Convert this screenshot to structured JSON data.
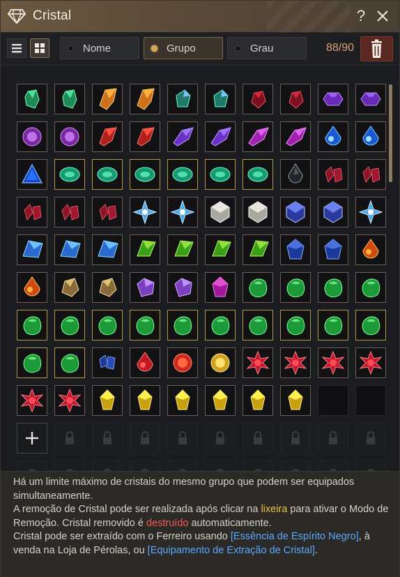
{
  "window": {
    "title": "Cristal"
  },
  "toolbar": {
    "sort_name": "Nome",
    "sort_group": "Grupo",
    "sort_grade": "Grau",
    "active_sort": "Grupo",
    "count": "88/90"
  },
  "colors": {
    "accent": "#d9a54a",
    "count": "#e0a070",
    "trash": "#5a2820",
    "highlight_yellow": "#f0c440",
    "highlight_red": "#f05a5a",
    "highlight_blue": "#5aa8ff"
  },
  "icons": [
    "diamond-logo-icon",
    "help-icon",
    "close-icon",
    "list-view-icon",
    "grid-view-icon",
    "trash-icon",
    "add-icon",
    "lock-icon"
  ],
  "grid": {
    "rows": [
      [
        "emerald-dark",
        "emerald-dark",
        "amber-shard",
        "amber-shard",
        "teal-gem",
        "teal-gem",
        "ruby-dark",
        "ruby-dark",
        "violet-hex",
        "violet-hex"
      ],
      [
        "amethyst-round",
        "amethyst-round",
        "red-shard",
        "red-shard",
        "violet-shard",
        "violet-shard",
        "magenta-shard",
        "magenta-shard",
        "blue-drop",
        "blue-drop"
      ],
      [
        "blue-triangle",
        "green-oval",
        "green-oval",
        "green-oval",
        "green-oval",
        "green-oval",
        "green-oval",
        "black-drop",
        "dark-ruby-cluster",
        "dark-ruby-cluster"
      ],
      [
        "dark-ruby-cluster",
        "dark-ruby-cluster",
        "dark-ruby-cluster",
        "ice-star",
        "ice-star",
        "silver-cube",
        "silver-cube",
        "blue-cube",
        "blue-cube",
        "ice-star"
      ],
      [
        "blue-prism",
        "blue-prism",
        "blue-prism",
        "green-kite",
        "green-kite",
        "green-kite",
        "green-kite",
        "navy-star",
        "navy-star",
        "fire-drop"
      ],
      [
        "fire-drop",
        "gold-chunk",
        "gold-chunk",
        "purple-gem",
        "purple-gem",
        "magenta-gem",
        "green-stone",
        "green-stone",
        "green-stone",
        "green-stone"
      ],
      [
        "green-stone",
        "green-stone",
        "green-stone",
        "green-stone",
        "green-stone",
        "green-stone",
        "green-stone",
        "green-stone",
        "green-stone",
        "green-stone"
      ],
      [
        "green-stone",
        "green-stone",
        "sapphire-cluster",
        "red-drop",
        "red-sun",
        "gold-sun",
        "red-star",
        "red-star",
        "red-star",
        "red-star"
      ],
      [
        "red-star",
        "red-star",
        "yellow-crystal",
        "yellow-crystal",
        "yellow-crystal",
        "yellow-crystal",
        "yellow-crystal",
        "yellow-crystal",
        "empty",
        "empty"
      ],
      [
        "add",
        "locked",
        "locked",
        "locked",
        "locked",
        "locked",
        "locked",
        "locked",
        "locked",
        "locked"
      ],
      [
        "locked",
        "locked",
        "locked",
        "locked",
        "locked",
        "locked",
        "locked",
        "locked",
        "locked",
        "locked"
      ]
    ]
  },
  "info": {
    "line1": "Há um limite máximo de cristais do mesmo grupo que podem ser equipados simultaneamente.",
    "line2_a": "A remoção de Cristal pode ser realizada após clicar na ",
    "line2_hl": "lixeira",
    "line2_b": " para ativar o Modo de Remoção. Cristal removido é ",
    "line2_hl2": "destruído",
    "line2_c": " automaticamente.",
    "line3_a": "Cristal pode ser extraído com o Ferreiro usando ",
    "line3_hl": "[Essência de Espírito Negro]",
    "line3_b": ", à venda na Loja de Pérolas, ou ",
    "line3_hl2": "[Equipamento de Extração de Cristal]",
    "line3_c": "."
  }
}
